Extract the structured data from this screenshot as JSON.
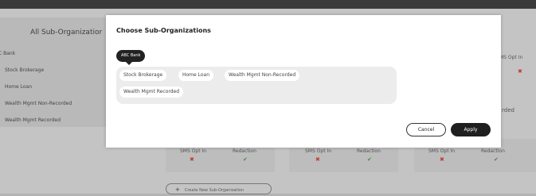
{
  "background": {
    "left_panel": {
      "title": "All Sub-Organizatior",
      "items": [
        "BC Bank",
        "Stock Brokerage",
        "Home Loan",
        "Wealth Mgmt Non-Recorded",
        "Wealth Mgmt Recorded"
      ]
    },
    "cards": [
      {
        "sms_label": "SMS Opt In",
        "redaction_label": "Redaction",
        "sms_mark": "✖",
        "redaction_mark": "✔"
      },
      {
        "sms_label": "SMS Opt In",
        "redaction_label": "Redaction",
        "sms_mark": "✖",
        "redaction_mark": "✔"
      },
      {
        "sms_label": "SMS Opt In",
        "redaction_label": "Redaction",
        "sms_mark": "✖",
        "redaction_mark": "✔"
      }
    ],
    "right_edge": {
      "sms_label": "MS Opt In",
      "sms_mark": "✖",
      "partial_label": "rded"
    },
    "create_button_label": "Create New Sub-Organization"
  },
  "modal": {
    "title": "Choose Sub-Organizations",
    "root_chip": "ABC Bank",
    "sub_chips": [
      "Stock Brokerage",
      "Home Loan",
      "Wealth Mgmt Non-Recorded",
      "Wealth Mgmt Recorded"
    ],
    "cancel_label": "Cancel",
    "apply_label": "Apply"
  },
  "colors": {
    "accent_dark": "#1f1f1f",
    "error_x": "#c0392b",
    "success_check": "#3f8a3f"
  }
}
